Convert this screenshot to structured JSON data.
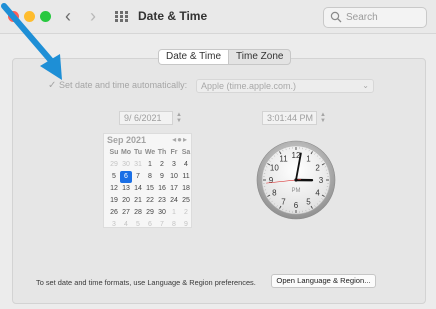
{
  "window": {
    "title": "Date & Time",
    "search_placeholder": "Search",
    "tabs": [
      {
        "label": "Date & Time",
        "active": true
      },
      {
        "label": "Time Zone",
        "active": false
      }
    ]
  },
  "auto_time": {
    "label": "Set date and time automatically:",
    "checked": true,
    "server": "Apple (time.apple.com.)"
  },
  "date_field": {
    "value": "9/  6/2021"
  },
  "time_field": {
    "value": "3:01:44 PM"
  },
  "calendar": {
    "month_label": "Sep 2021",
    "weekday_headers": [
      "Su",
      "Mo",
      "Tu",
      "We",
      "Th",
      "Fr",
      "Sa"
    ],
    "weeks": [
      [
        "29",
        "30",
        "31",
        "1",
        "2",
        "3",
        "4"
      ],
      [
        "5",
        "6",
        "7",
        "8",
        "9",
        "10",
        "11"
      ],
      [
        "12",
        "13",
        "14",
        "15",
        "16",
        "17",
        "18"
      ],
      [
        "19",
        "20",
        "21",
        "22",
        "23",
        "24",
        "25"
      ],
      [
        "26",
        "27",
        "28",
        "29",
        "30",
        "1",
        "2"
      ],
      [
        "3",
        "4",
        "5",
        "6",
        "7",
        "8",
        "9"
      ]
    ],
    "selected_day": "6"
  },
  "clock": {
    "numerals": [
      "12",
      "1",
      "2",
      "3",
      "4",
      "5",
      "6",
      "7",
      "8",
      "9",
      "10",
      "11"
    ],
    "ampm": "PM",
    "hour": 3,
    "minute": 1,
    "second": 44
  },
  "footer": {
    "text": "To set date and time formats, use Language & Region preferences.",
    "button_label": "Open Language & Region..."
  },
  "colors": {
    "accent": "#1a6fe6",
    "arrow": "#1e8fd6",
    "second_hand": "#d92b2b"
  }
}
